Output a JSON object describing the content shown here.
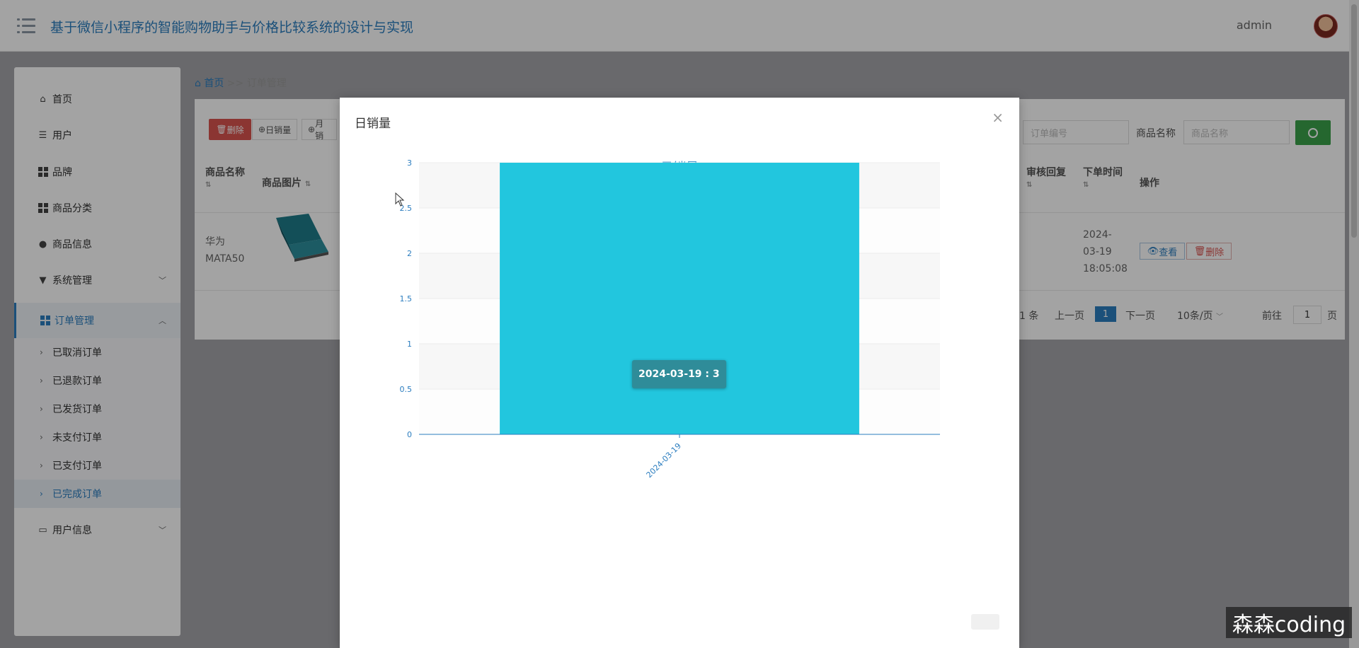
{
  "header": {
    "app_title": "基于微信小程序的智能购物助手与价格比较系统的设计与实现",
    "user_name": "admin"
  },
  "sidebar": {
    "items": [
      {
        "label": "首页",
        "icon": "home-icon"
      },
      {
        "label": "用户",
        "icon": "list-icon"
      },
      {
        "label": "品牌",
        "icon": "grid-icon"
      },
      {
        "label": "商品分类",
        "icon": "grid-icon"
      },
      {
        "label": "商品信息",
        "icon": "user-icon"
      },
      {
        "label": "系统管理",
        "icon": "brush-icon",
        "chevron": "chevron-down-icon"
      },
      {
        "label": "订单管理",
        "icon": "grid-icon",
        "chevron": "chevron-up-icon",
        "active": true
      },
      {
        "label": "用户信息",
        "icon": "card-icon",
        "chevron": "chevron-down-icon"
      }
    ],
    "sub_items": [
      {
        "label": "已取消订单"
      },
      {
        "label": "已退款订单"
      },
      {
        "label": "已发货订单"
      },
      {
        "label": "未支付订单"
      },
      {
        "label": "已支付订单"
      },
      {
        "label": "已完成订单",
        "current": true
      }
    ]
  },
  "breadcrumb": {
    "home": "首页",
    "separator": ">>",
    "current": "订单管理"
  },
  "toolbar": {
    "delete_label": "删除",
    "daily_label": "日销量",
    "monthly_label": "月销"
  },
  "search": {
    "order_no_placeholder": "订单编号",
    "product_name_label": "商品名称",
    "product_name_placeholder": "商品名称"
  },
  "table": {
    "headers": [
      "商品名称",
      "商品图片",
      "审核回复",
      "下单时间",
      "操作"
    ],
    "rows": [
      {
        "product_name": "华为MATA50",
        "order_time": "2024-03-19 18:05:08",
        "view_label": "查看",
        "delete_label": "删除"
      }
    ]
  },
  "pagination": {
    "total_text": "1 条",
    "prev_label": "上一页",
    "current_page": "1",
    "next_label": "下一页",
    "page_size_label": "10条/页",
    "goto_label": "前往",
    "goto_value": "1",
    "page_suffix": "页"
  },
  "modal": {
    "title": "日销量",
    "close_icon": "close-icon",
    "tooltip_text": "2024-03-19 : 3"
  },
  "chart_data": {
    "type": "bar",
    "title": "日销量",
    "categories": [
      "2024-03-19"
    ],
    "values": [
      3
    ],
    "ylim": [
      0,
      3
    ],
    "yticks": [
      0,
      0.5,
      1,
      1.5,
      2,
      2.5,
      3
    ],
    "grid": true,
    "bar_color": "#22c6de"
  },
  "watermark": "森森coding",
  "colors": {
    "accent": "#2b7dbf",
    "danger": "#d9534f",
    "success": "#3aa14a",
    "bar": "#22c6de",
    "tooltip": "#2f8c99"
  }
}
